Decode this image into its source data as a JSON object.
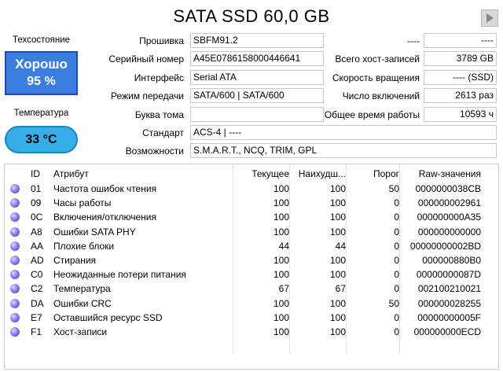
{
  "title": "SATA SSD 60,0 GB",
  "health": {
    "label": "Техсостояние",
    "status": "Хорошо",
    "percent": "95 %"
  },
  "temperature": {
    "label": "Температура",
    "value": "33 °C"
  },
  "info_left": [
    {
      "label": "Прошивка",
      "value": "SBFM91.2"
    },
    {
      "label": "Серийный номер",
      "value": "A45E0786158000446641"
    },
    {
      "label": "Интерфейс",
      "value": "Serial ATA"
    },
    {
      "label": "Режим передачи",
      "value": "SATA/600 | SATA/600"
    },
    {
      "label": "Буква тома",
      "value": ""
    },
    {
      "label": "Стандарт",
      "value": "ACS-4 | ----"
    },
    {
      "label": "Возможности",
      "value": "S.M.A.R.T., NCQ, TRIM, GPL"
    }
  ],
  "info_right": [
    {
      "label": "----",
      "value": "----"
    },
    {
      "label": "Всего хост-записей",
      "value": "3789 GB"
    },
    {
      "label": "Скорость вращения",
      "value": "---- (SSD)"
    },
    {
      "label": "Число включений",
      "value": "2613 раз"
    },
    {
      "label": "Общее время работы",
      "value": "10593 ч"
    }
  ],
  "table": {
    "headers": {
      "id": "ID",
      "name": "Атрибут",
      "current": "Текущее",
      "worst": "Наихудш...",
      "threshold": "Порог",
      "raw": "Raw-значения"
    },
    "rows": [
      {
        "id": "01",
        "name": "Частота ошибок чтения",
        "current": "100",
        "worst": "100",
        "threshold": "50",
        "raw": "0000000038CB"
      },
      {
        "id": "09",
        "name": "Часы работы",
        "current": "100",
        "worst": "100",
        "threshold": "0",
        "raw": "000000002961"
      },
      {
        "id": "0C",
        "name": "Включения/отключения",
        "current": "100",
        "worst": "100",
        "threshold": "0",
        "raw": "000000000A35"
      },
      {
        "id": "A8",
        "name": "Ошибки SATA PHY",
        "current": "100",
        "worst": "100",
        "threshold": "0",
        "raw": "000000000000"
      },
      {
        "id": "AA",
        "name": "Плохие блоки",
        "current": "44",
        "worst": "44",
        "threshold": "0",
        "raw": "00000000002BD"
      },
      {
        "id": "AD",
        "name": "Стирания",
        "current": "100",
        "worst": "100",
        "threshold": "0",
        "raw": "000000880B0"
      },
      {
        "id": "C0",
        "name": "Неожиданные потери питания",
        "current": "100",
        "worst": "100",
        "threshold": "0",
        "raw": "00000000087D"
      },
      {
        "id": "C2",
        "name": "Температура",
        "current": "67",
        "worst": "67",
        "threshold": "0",
        "raw": "002100210021"
      },
      {
        "id": "DA",
        "name": "Ошибки CRC",
        "current": "100",
        "worst": "100",
        "threshold": "50",
        "raw": "000000028255"
      },
      {
        "id": "E7",
        "name": "Оставшийся ресурс SSD",
        "current": "100",
        "worst": "100",
        "threshold": "0",
        "raw": "00000000005F"
      },
      {
        "id": "F1",
        "name": "Хост-записи",
        "current": "100",
        "worst": "100",
        "threshold": "0",
        "raw": "000000000ECD"
      }
    ]
  }
}
